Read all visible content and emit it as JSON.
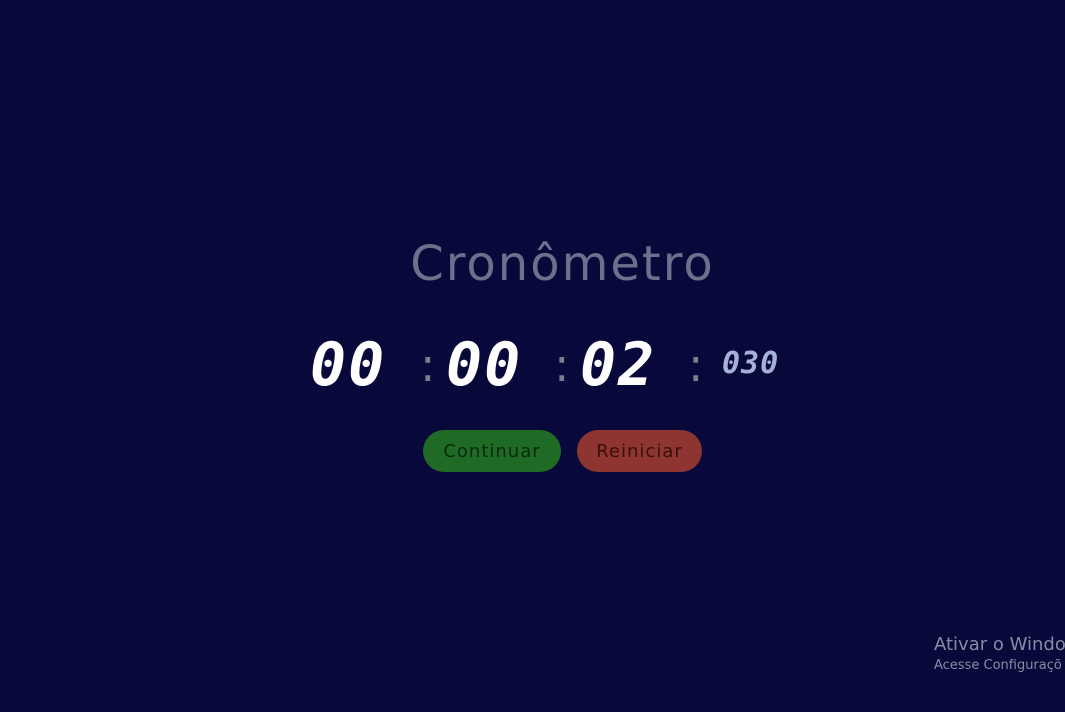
{
  "title": "Cronômetro",
  "timer": {
    "hours": "00",
    "minutes": "00",
    "seconds": "02",
    "milliseconds": "030",
    "separator": ":"
  },
  "buttons": {
    "continue_label": "Continuar",
    "reset_label": "Reiniciar"
  },
  "watermark": {
    "title": "Ativar o Windo",
    "subtitle": "Acesse Configuraçõ"
  },
  "colors": {
    "background": "#08083a",
    "title": "#6e6f8c",
    "digits": "#ffffff",
    "milliseconds": "#a5b1d6",
    "continue_button": "#1f6b26",
    "reset_button": "#8e3531"
  }
}
